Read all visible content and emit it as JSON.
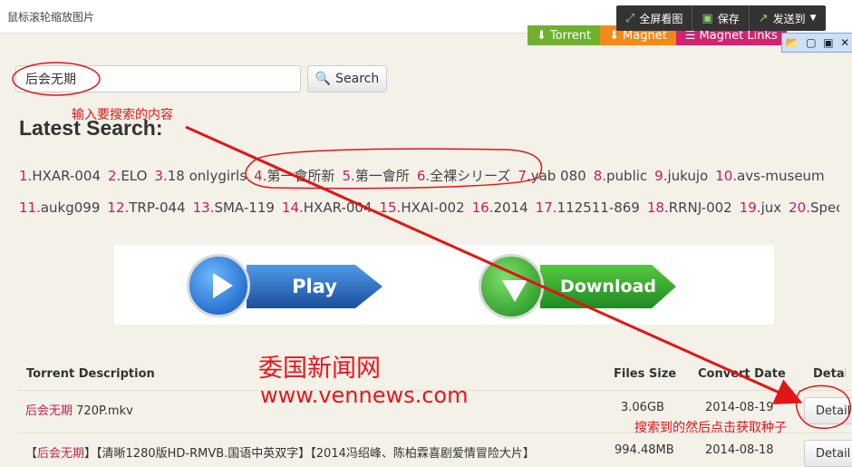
{
  "window": {
    "title": "鼠标滚轮缩放图片"
  },
  "viewer_tools": [
    {
      "label": "全屏看图",
      "icon": "fullscreen-icon"
    },
    {
      "label": "保存",
      "icon": "save-icon"
    },
    {
      "label": "发送到",
      "icon": "send-icon"
    }
  ],
  "tabs": [
    {
      "label": "Torrent",
      "icon": "torrent-icon"
    },
    {
      "label": "Magnet",
      "icon": "magnet-icon"
    },
    {
      "label": "Magnet Links",
      "icon": "list-icon"
    }
  ],
  "search": {
    "value": "后会无期",
    "button_label": "Search"
  },
  "annotations": {
    "input_hint": "输入要搜索的内容",
    "click_hint": "搜索到的然后点击获取种子"
  },
  "latest": {
    "title": "Latest Search:",
    "rows": [
      [
        {
          "n": "1.",
          "t": "HXAR-004"
        },
        {
          "n": "2.",
          "t": "ELO"
        },
        {
          "n": "3.",
          "t": "18 onlygirls"
        },
        {
          "n": "4.",
          "t": "第一會所新"
        },
        {
          "n": "5.",
          "t": "第一會所"
        },
        {
          "n": "6.",
          "t": "全裸シリーズ"
        },
        {
          "n": "7.",
          "t": "yab 080"
        },
        {
          "n": "8.",
          "t": "public"
        },
        {
          "n": "9.",
          "t": "jukujo"
        },
        {
          "n": "10.",
          "t": "avs-museum"
        }
      ],
      [
        {
          "n": "11.",
          "t": "aukg099"
        },
        {
          "n": "12.",
          "t": "TRP-044"
        },
        {
          "n": "13.",
          "t": "SMA-119"
        },
        {
          "n": "14.",
          "t": "HXAR-004"
        },
        {
          "n": "15.",
          "t": "HXAI-002"
        },
        {
          "n": "16.",
          "t": "2014"
        },
        {
          "n": "17.",
          "t": "112511-869"
        },
        {
          "n": "18.",
          "t": "RRNJ-002"
        },
        {
          "n": "19.",
          "t": "jux"
        },
        {
          "n": "20.",
          "t": "Special"
        }
      ]
    ]
  },
  "banner": {
    "play_label": "Play",
    "download_label": "Download"
  },
  "table": {
    "headers": {
      "description": "Torrent Description",
      "size": "Files Size",
      "date": "Convert Date",
      "detail": "Detail"
    },
    "rows": [
      {
        "hl": "后会无期",
        "rest": " 720P.mkv",
        "size": "3.06GB",
        "date": "2014-08-19",
        "detail": "Detail"
      },
      {
        "pre": "【",
        "hl": "后会无期",
        "rest": "】【清晰1280版HD-RMVB.国语中英双字】【2014冯绍峰、陈柏霖喜剧爱情冒险大片】",
        "size": "994.48MB",
        "date": "2014-08-18",
        "detail": "Detail"
      }
    ]
  },
  "watermark": {
    "cn": "委国新闻网",
    "url": "www.vennews.com"
  },
  "colors": {
    "accent_red": "#e01515",
    "tag_number": "#c01f55",
    "page_bg": "#f4f1e9"
  }
}
